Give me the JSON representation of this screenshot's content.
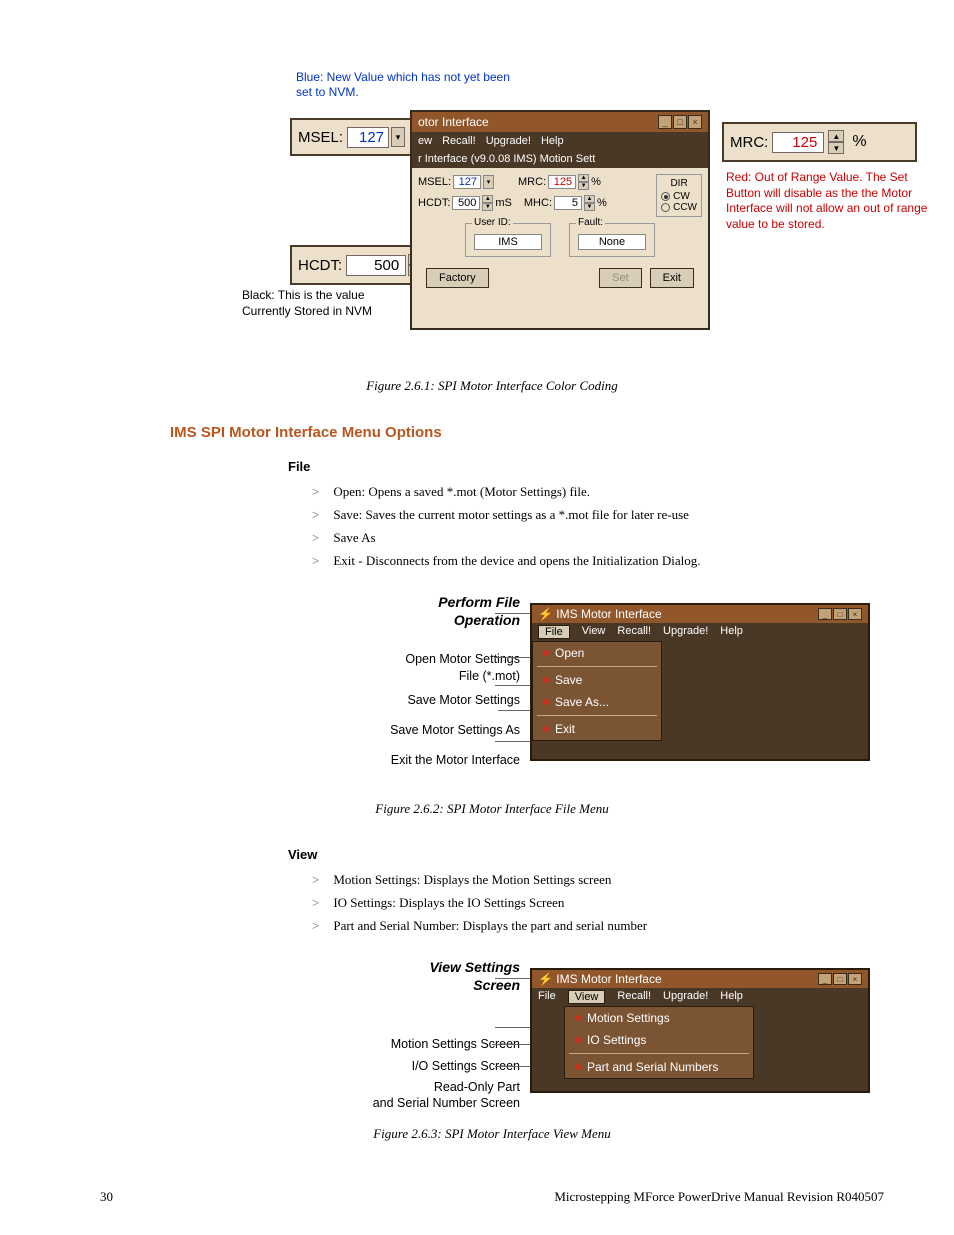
{
  "notes": {
    "blue": "Blue: New Value which has not yet been set to NVM.",
    "red": "Red: Out of Range Value. The Set Button will disable as the the Motor Interface will not allow an out of range value to be stored.",
    "black_line1": "Black: This is the value",
    "black_line2": "Currently Stored in NVM"
  },
  "callouts": {
    "msel_label": "MSEL:",
    "msel_value": "127",
    "hcdt_label": "HCDT:",
    "hcdt_value": "500",
    "mrc_label": "MRC:",
    "mrc_value": "125",
    "mrc_unit": "%"
  },
  "mainwin": {
    "title_partial": "otor Interface",
    "menu": {
      "m1": "ew",
      "m2": "Recall!",
      "m3": "Upgrade!",
      "m4": "Help"
    },
    "subtitle": "r Interface (v9.0.08 IMS) Motion Sett",
    "row1": {
      "msel_l": "MSEL:",
      "msel_v": "127",
      "mrc_l": "MRC:",
      "mrc_v": "125",
      "mrc_u": "%"
    },
    "row2": {
      "hcdt_l": "HCDT:",
      "hcdt_v": "500",
      "hcdt_u": "mS",
      "mhc_l": "MHC:",
      "mhc_v": "5",
      "mhc_u": "%"
    },
    "dir": {
      "head": "DIR",
      "cw": "CW",
      "ccw": "CCW"
    },
    "userid_h": "User ID:",
    "userid_v": "IMS",
    "fault_h": "Fault:",
    "fault_v": "None",
    "btn_factory": "Factory",
    "btn_set": "Set",
    "btn_exit": "Exit"
  },
  "captions": {
    "fig1": "Figure 2.6.1: SPI Motor Interface Color Coding",
    "fig2": "Figure 2.6.2: SPI Motor Interface File Menu",
    "fig3": "Figure 2.6.3: SPI Motor Interface View Menu"
  },
  "headings": {
    "section": "IMS SPI Motor Interface Menu Options",
    "file": "File",
    "view": "View"
  },
  "file_items": {
    "i1": "Open: Opens a saved *.mot (Motor Settings) file.",
    "i2": "Save: Saves the current motor settings as a *.mot file for later re-use",
    "i3": "Save As",
    "i4": "Exit - Disconnects from the device and opens the Initialization Dialog."
  },
  "view_items": {
    "i1": "Motion Settings: Displays the Motion Settings screen",
    "i2": "IO Settings: Displays the IO Settings Screen",
    "i3": "Part and Serial Number: Displays the part and serial number"
  },
  "fig2": {
    "head1": "Perform File",
    "head2": "Operation",
    "l1a": "Open Motor Settings",
    "l1b": "File (*.mot)",
    "l2": "Save Motor Settings",
    "l3": "Save Motor Settings As",
    "l4": "Exit the Motor Interface",
    "win_title": "IMS Motor Interface",
    "menu": {
      "file": "File",
      "view": "View",
      "recall": "Recall!",
      "upgrade": "Upgrade!",
      "help": "Help"
    },
    "dd": {
      "open": "Open",
      "save": "Save",
      "saveas": "Save As...",
      "exit": "Exit"
    }
  },
  "fig3": {
    "head1": "View Settings",
    "head2": "Screen",
    "l1": "Motion Settings Screen",
    "l2": "I/O Settings Screen",
    "l3a": "Read-Only Part",
    "l3b": "and Serial Number Screen",
    "win_title": "IMS Motor Interface",
    "menu": {
      "file": "File",
      "view": "View",
      "recall": "Recall!",
      "upgrade": "Upgrade!",
      "help": "Help"
    },
    "dd": {
      "motion": "Motion Settings",
      "io": "IO Settings",
      "psn": "Part and Serial Numbers"
    }
  },
  "footer": {
    "page": "30",
    "doc": "Microstepping MForce PowerDrive Manual Revision R040507"
  },
  "bullet": ">"
}
